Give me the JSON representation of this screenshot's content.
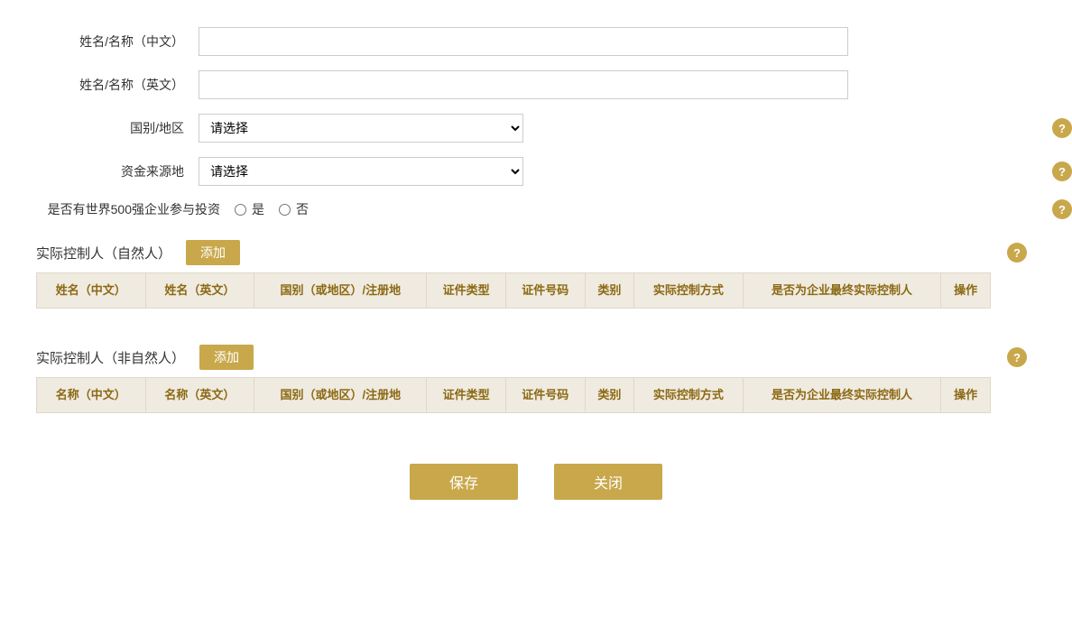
{
  "form": {
    "name_cn_label": "姓名/名称（中文）",
    "name_en_label": "姓名/名称（英文）",
    "country_label": "国别/地区",
    "country_placeholder": "请选择",
    "fund_source_label": "资金来源地",
    "fund_source_placeholder": "请选择",
    "fortune500_label": "是否有世界500强企业参与投资",
    "yes_label": "是",
    "no_label": "否"
  },
  "natural_person_section": {
    "title": "实际控制人（自然人）",
    "add_btn": "添加",
    "columns": [
      "姓名（中文）",
      "姓名（英文）",
      "国别（或地区）/注册地",
      "证件类型",
      "证件号码",
      "类别",
      "实际控制方式",
      "是否为企业最终实际控制人",
      "操作"
    ]
  },
  "non_natural_person_section": {
    "title": "实际控制人（非自然人）",
    "add_btn": "添加",
    "columns": [
      "名称（中文）",
      "名称（英文）",
      "国别（或地区）/注册地",
      "证件类型",
      "证件号码",
      "类别",
      "实际控制方式",
      "是否为企业最终实际控制人",
      "操作"
    ]
  },
  "buttons": {
    "save": "保存",
    "close": "关闭"
  },
  "help_icon": "?",
  "colors": {
    "gold": "#c8a84b",
    "table_header_bg": "#f0ebe0",
    "table_border": "#e0d8c8",
    "table_text": "#8b6914"
  }
}
